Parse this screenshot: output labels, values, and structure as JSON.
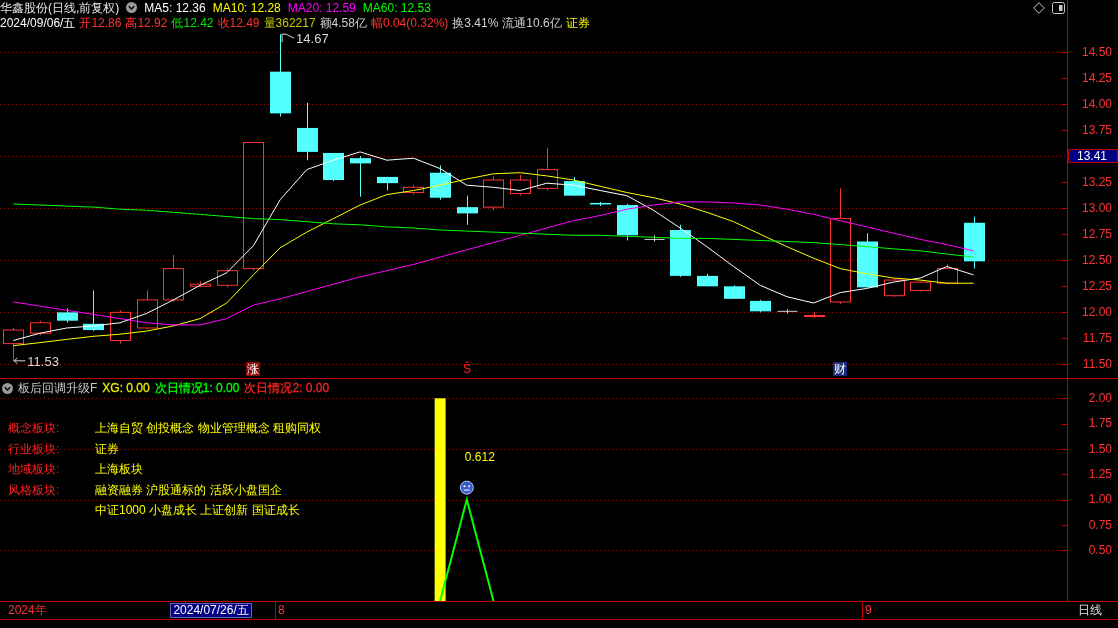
{
  "header": {
    "title": "华鑫股份(日线,前复权)",
    "ma_legend": [
      {
        "text": "MA5: 12.36",
        "color": "#ffffff"
      },
      {
        "text": "MA10: 12.28",
        "color": "#ffff00"
      },
      {
        "text": "MA20: 12.59",
        "color": "#ff00ff"
      },
      {
        "text": "MA60: 12.53",
        "color": "#00ff00"
      }
    ],
    "quote": [
      {
        "text": "2024/09/06/五",
        "color": "#ffffff"
      },
      {
        "text": "开12.86",
        "color": "#ff3232"
      },
      {
        "text": "高12.92",
        "color": "#ff3232"
      },
      {
        "text": "低12.42",
        "color": "#00e600"
      },
      {
        "text": "收12.49",
        "color": "#ff3232"
      },
      {
        "text": "量362217",
        "color": "#c8c800"
      },
      {
        "text": "额4.58亿",
        "color": "#d0d0d0"
      },
      {
        "text": "幅0.04(0.32%)",
        "color": "#ff3232"
      },
      {
        "text": "换3.41%",
        "color": "#d0d0d0"
      },
      {
        "text": "流通10.6亿",
        "color": "#d0d0d0"
      },
      {
        "text": "证券",
        "color": "#ffff00"
      }
    ]
  },
  "price_chart": {
    "chart_data": {
      "type": "candlestick",
      "categories": [
        null,
        null,
        null,
        null,
        null,
        null,
        null,
        null,
        null,
        null,
        null,
        null,
        null,
        null,
        null,
        null,
        null,
        null,
        null,
        null,
        null,
        null,
        null,
        null,
        null,
        null,
        null,
        null,
        null,
        null,
        null,
        null,
        null,
        null,
        null,
        null,
        null,
        null,
        null,
        null
      ],
      "ylim": [
        11.37,
        14.71
      ],
      "yticks": [
        {
          "value": 11.5,
          "label": "11.50"
        },
        {
          "value": 11.75,
          "label": "11.75"
        },
        {
          "value": 12,
          "label": "12.00"
        },
        {
          "value": 12.25,
          "label": "12.25"
        },
        {
          "value": 12.5,
          "label": "12.50"
        },
        {
          "value": 12.75,
          "label": "12.75"
        },
        {
          "value": 13,
          "label": "13.00"
        },
        {
          "value": 13.25,
          "label": "13.25"
        },
        {
          "value": 13.75,
          "label": "13.75"
        },
        {
          "value": 14,
          "label": "14.00"
        },
        {
          "value": 14.25,
          "label": "14.25"
        },
        {
          "value": 14.5,
          "label": "14.50"
        }
      ],
      "grid": true,
      "ohlc": [
        [
          11.7,
          11.85,
          11.53,
          11.83
        ],
        [
          11.8,
          11.92,
          11.78,
          11.9
        ],
        [
          12.0,
          12.04,
          11.9,
          11.92
        ],
        [
          11.89,
          12.21,
          11.82,
          11.83
        ],
        [
          11.73,
          12.02,
          11.7,
          12.0
        ],
        [
          11.85,
          12.21,
          11.84,
          12.12
        ],
        [
          12.12,
          12.55,
          12.1,
          12.42
        ],
        [
          12.25,
          12.3,
          12.24,
          12.27
        ],
        [
          12.26,
          12.42,
          12.24,
          12.4
        ],
        [
          12.42,
          13.63,
          12.4,
          13.63
        ],
        [
          14.31,
          14.67,
          13.88,
          13.91
        ],
        [
          13.77,
          14.01,
          13.46,
          13.54
        ],
        [
          13.53,
          13.53,
          13.26,
          13.27
        ],
        [
          13.48,
          13.5,
          13.11,
          13.43
        ],
        [
          13.3,
          13.3,
          13.17,
          13.24
        ],
        [
          13.15,
          13.22,
          13.13,
          13.2
        ],
        [
          13.34,
          13.41,
          13.08,
          13.1
        ],
        [
          13.01,
          13.12,
          12.84,
          12.95
        ],
        [
          13.01,
          13.3,
          12.98,
          13.27
        ],
        [
          13.14,
          13.32,
          13.12,
          13.27
        ],
        [
          13.19,
          13.58,
          13.17,
          13.37
        ],
        [
          13.26,
          13.3,
          13.12,
          13.12
        ],
        [
          13.05,
          13.06,
          13.02,
          13.04
        ],
        [
          13.03,
          13.04,
          12.69,
          12.74
        ],
        [
          12.7,
          12.74,
          12.68,
          12.7
        ],
        [
          12.79,
          12.84,
          12.34,
          12.35
        ],
        [
          12.35,
          12.37,
          12.25,
          12.25
        ],
        [
          12.25,
          12.26,
          12.13,
          12.13
        ],
        [
          12.11,
          12.12,
          12.0,
          12.01
        ],
        [
          12.01,
          12.03,
          11.99,
          12.01
        ],
        [
          11.96,
          12.0,
          11.95,
          11.97
        ],
        [
          12.1,
          13.19,
          12.08,
          12.9
        ],
        [
          12.68,
          12.76,
          12.24,
          12.24
        ],
        [
          12.16,
          12.33,
          12.15,
          12.31
        ],
        [
          12.21,
          12.3,
          12.2,
          12.29
        ],
        [
          12.28,
          12.46,
          12.27,
          12.42
        ],
        [
          12.86,
          12.92,
          12.42,
          12.49
        ],
        null,
        null,
        null
      ],
      "series": [
        {
          "type": "line",
          "color": "#ffffff",
          "values": [
            11.73,
            11.8,
            11.85,
            11.87,
            11.9,
            11.99,
            12.12,
            12.26,
            12.38,
            12.64,
            13.08,
            13.37,
            13.46,
            13.54,
            13.46,
            13.48,
            13.38,
            13.22,
            13.2,
            13.17,
            13.24,
            13.22,
            13.17,
            13.12,
            12.98,
            12.81,
            12.63,
            12.44,
            12.26,
            12.15,
            12.09,
            12.19,
            12.23,
            12.29,
            12.33,
            12.44,
            12.36,
            null,
            null,
            null
          ]
        },
        {
          "type": "line",
          "color": "#ffff00",
          "values": [
            11.68,
            11.71,
            11.74,
            11.77,
            11.79,
            11.82,
            11.87,
            11.94,
            12.09,
            12.36,
            12.62,
            12.77,
            12.9,
            13.03,
            13.13,
            13.17,
            13.22,
            13.28,
            13.33,
            13.34,
            13.31,
            13.27,
            13.21,
            13.15,
            13.1,
            13.04,
            12.96,
            12.87,
            12.75,
            12.63,
            12.52,
            12.42,
            12.37,
            12.33,
            12.31,
            12.28,
            12.28,
            null,
            null,
            null
          ]
        },
        {
          "type": "line",
          "color": "#ff00ff",
          "values": [
            12.1,
            12.06,
            12.02,
            11.98,
            11.94,
            11.9,
            11.88,
            11.88,
            11.94,
            12.07,
            12.13,
            12.2,
            12.27,
            12.34,
            12.4,
            12.46,
            12.53,
            12.6,
            12.67,
            12.74,
            12.81,
            12.88,
            12.93,
            12.99,
            13.03,
            13.06,
            13.06,
            13.05,
            13.03,
            12.99,
            12.94,
            12.88,
            12.82,
            12.76,
            12.7,
            12.65,
            12.59,
            null,
            null,
            null
          ]
        },
        {
          "type": "line",
          "color": "#00ff00",
          "values": [
            13.04,
            13.03,
            13.02,
            13.01,
            12.99,
            12.98,
            12.96,
            12.94,
            12.92,
            12.9,
            12.89,
            12.87,
            12.85,
            12.84,
            12.82,
            12.81,
            12.79,
            12.78,
            12.77,
            12.76,
            12.75,
            12.74,
            12.74,
            12.73,
            12.72,
            12.71,
            12.71,
            12.7,
            12.69,
            12.68,
            12.67,
            12.65,
            12.63,
            12.61,
            12.59,
            12.56,
            12.53,
            null,
            null,
            null
          ]
        }
      ],
      "annotations": [
        "14.67",
        "11.53"
      ]
    },
    "events": [
      {
        "text": "涨",
        "color": "#8c0c0c",
        "boxed": true
      },
      {
        "text": "Ŝ",
        "color": "#ff2020",
        "boxed": false
      },
      {
        "text": "财",
        "color": "#1e2c78",
        "boxed": true
      }
    ],
    "cursor_price": "13.41"
  },
  "indicator_panel": {
    "name": "板后回调升级F",
    "outputs": [
      {
        "text": "XG: 0.00",
        "color": "#e8e800"
      },
      {
        "text": "次日情况1: 0.00",
        "color": "#00ff00"
      },
      {
        "text": "次日情况2: 0.00",
        "color": "#ff2020"
      }
    ],
    "sector_info": [
      {
        "label": "概念板块:",
        "values": [
          "上海自贸 创投概念 物业管理概念 租购同权"
        ]
      },
      {
        "label": "行业板块:",
        "values": [
          "证券"
        ]
      },
      {
        "label": "地域板块:",
        "values": [
          "上海板块"
        ]
      },
      {
        "label": "风格板块:",
        "values": [
          "融资融券 沪股通标的 活跃小盘国企",
          "中证1000 小盘成长 上证创新 国证成长"
        ]
      }
    ],
    "chart_data": {
      "type": "bar",
      "categories": [
        null,
        null,
        null,
        null,
        null,
        null,
        null,
        null,
        null,
        null,
        "8",
        null,
        null,
        null,
        null,
        null,
        null,
        null,
        null,
        null,
        null,
        null,
        null,
        null,
        null,
        null,
        null,
        null,
        null,
        null,
        null,
        null,
        "9",
        null,
        null,
        null,
        null,
        null,
        null,
        null
      ],
      "ylim": [
        0,
        2.19
      ],
      "yticks": [
        {
          "value": 0.5,
          "label": "0.50"
        },
        {
          "value": 0.75,
          "label": "0.75"
        },
        {
          "value": 1,
          "label": "1.00"
        },
        {
          "value": 1.25,
          "label": "1.25"
        },
        {
          "value": 1.5,
          "label": "1.50"
        },
        {
          "value": 1.75,
          "label": "1.75"
        },
        {
          "value": 2,
          "label": "2.00"
        }
      ],
      "grid": true,
      "series": [
        {
          "color": "#ffff00",
          "values": [
            null,
            null,
            null,
            null,
            null,
            null,
            null,
            null,
            null,
            null,
            null,
            null,
            null,
            null,
            null,
            null,
            2.0,
            null,
            null,
            null,
            null,
            null,
            null,
            null,
            null,
            null,
            null,
            null,
            null,
            null,
            null,
            null,
            null,
            null,
            null,
            null,
            null,
            null,
            null,
            null
          ]
        },
        {
          "type": "line",
          "color": "#00ff00",
          "values": [
            null,
            null,
            null,
            null,
            null,
            null,
            null,
            null,
            null,
            null,
            null,
            null,
            null,
            null,
            null,
            null,
            0,
            1.0,
            0,
            null,
            null,
            null,
            null,
            null,
            null,
            null,
            null,
            null,
            null,
            null,
            null,
            null,
            null,
            null,
            null,
            null,
            null,
            null,
            null,
            null
          ]
        }
      ],
      "annotations": [
        "0.612"
      ]
    }
  },
  "time_axis": {
    "year": "2024年",
    "cursor_date": "2024/07/26/五",
    "period": "日线"
  }
}
